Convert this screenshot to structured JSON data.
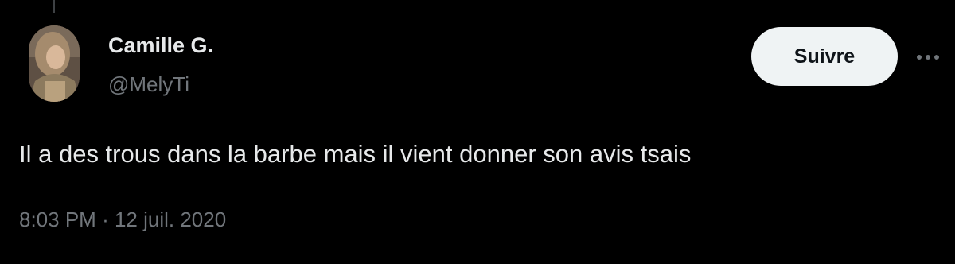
{
  "tweet": {
    "author": {
      "display_name": "Camille G.",
      "handle": "@MelyTi",
      "avatar_icon": "profile-photo"
    },
    "follow_button_label": "Suivre",
    "more_icon": "more-horizontal-icon",
    "text": "Il a des trous dans la barbe mais il vient donner son avis tsais",
    "time": "8:03 PM",
    "separator": "·",
    "date": "12 juil. 2020"
  },
  "colors": {
    "background": "#000000",
    "primary_text": "#e7e9ea",
    "secondary_text": "#71767b",
    "button_background": "#eff3f4",
    "button_text": "#0f1419"
  }
}
